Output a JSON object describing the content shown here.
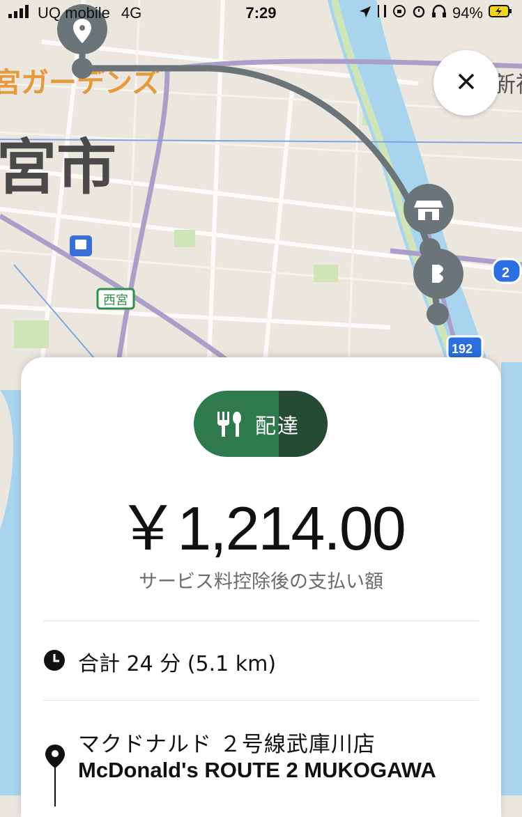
{
  "status_bar": {
    "carrier": "UQ mobile",
    "network": "4G",
    "time": "7:29",
    "battery": "94%"
  },
  "map": {
    "label_garden": "宮ガーデンズ",
    "label_city": "宮市",
    "label_nishinomiya": "西宮",
    "label_shin": "新神",
    "route_2": "2",
    "route_192": "192",
    "route_color": "#6b7478"
  },
  "close_button": {
    "icon": "close-icon"
  },
  "sheet": {
    "badge_label": "配達",
    "badge_color": "#2f7a4c",
    "amount": "￥1,214.00",
    "subtitle": "サービス料控除後の支払い額",
    "trip_summary": "合計 24 分 (5.1 km)",
    "store_name_jp": "マクドナルド ２号線武庫川店",
    "store_name_en": "McDonald's ROUTE 2 MUKOGAWA"
  }
}
